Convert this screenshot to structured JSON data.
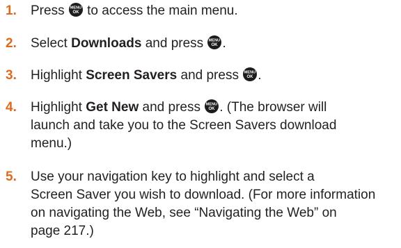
{
  "icon": {
    "name": "menu-ok-key",
    "top": "MENU",
    "bottom": "OK"
  },
  "steps": [
    {
      "num": "1.",
      "a": "Press ",
      "b": " to access the main menu."
    },
    {
      "num": "2.",
      "a": "Select ",
      "bold": "Downloads",
      "b": " and press ",
      "c": "."
    },
    {
      "num": "3.",
      "a": "Highlight ",
      "bold": "Screen Savers",
      "b": " and press ",
      "c": "."
    },
    {
      "num": "4.",
      "a": "Highlight ",
      "bold": "Get New",
      "b": " and press ",
      "c": ". (The browser will",
      "line2": "launch and take you to the Screen Savers download",
      "line3": "menu.)"
    },
    {
      "num": "5.",
      "line1": "Use your navigation key to highlight and select a",
      "line2": "Screen Saver you wish to download. (For more information",
      "line3": "on navigating the Web, see “Navigating the Web” on",
      "line4": "page 217.)"
    }
  ]
}
